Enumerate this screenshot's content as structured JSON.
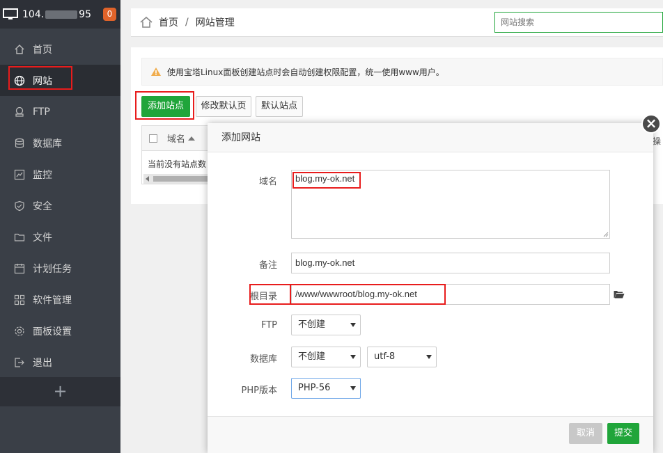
{
  "sidebar": {
    "ip_prefix": "104.",
    "ip_suffix": "95",
    "badge": "0",
    "items": [
      {
        "label": "首页",
        "icon": "home-icon"
      },
      {
        "label": "网站",
        "icon": "globe-icon",
        "active": true
      },
      {
        "label": "FTP",
        "icon": "ftp-icon"
      },
      {
        "label": "数据库",
        "icon": "database-icon"
      },
      {
        "label": "监控",
        "icon": "monitor-icon"
      },
      {
        "label": "安全",
        "icon": "shield-icon"
      },
      {
        "label": "文件",
        "icon": "folder-icon"
      },
      {
        "label": "计划任务",
        "icon": "calendar-icon"
      },
      {
        "label": "软件管理",
        "icon": "grid-icon"
      },
      {
        "label": "面板设置",
        "icon": "gear-icon"
      },
      {
        "label": "退出",
        "icon": "logout-icon"
      }
    ],
    "add_label": "+"
  },
  "header": {
    "crumb_home": "首页",
    "crumb_sep": "/",
    "crumb_current": "网站管理",
    "search_placeholder": "网站搜索"
  },
  "main": {
    "alert_text": "使用宝塔Linux面板创建站点时会自动创建权限配置，统一使用www用户。",
    "add_site_button": "添加站点",
    "modify_default_button": "修改默认页",
    "default_site_button": "默认站点",
    "table_domain_header": "域名",
    "table_empty_text": "当前没有站点数",
    "right_partial_label": "操"
  },
  "modal": {
    "title": "添加网站",
    "close_label": "×",
    "domain_label": "域名",
    "domain_value": "blog.my-ok.net",
    "remark_label": "备注",
    "remark_value": "blog.my-ok.net",
    "root_label": "根目录",
    "root_value": "/www/wwwroot/blog.my-ok.net",
    "ftp_label": "FTP",
    "ftp_value": "不创建",
    "db_label": "数据库",
    "db_value": "不创建",
    "db_charset": "utf-8",
    "php_label": "PHP版本",
    "php_value": "PHP-56",
    "cancel_button": "取消",
    "submit_button": "提交"
  },
  "colors": {
    "accent_green": "#20a53a",
    "highlight_red": "#e81c1c",
    "sidebar_bg": "#3a3f47"
  }
}
